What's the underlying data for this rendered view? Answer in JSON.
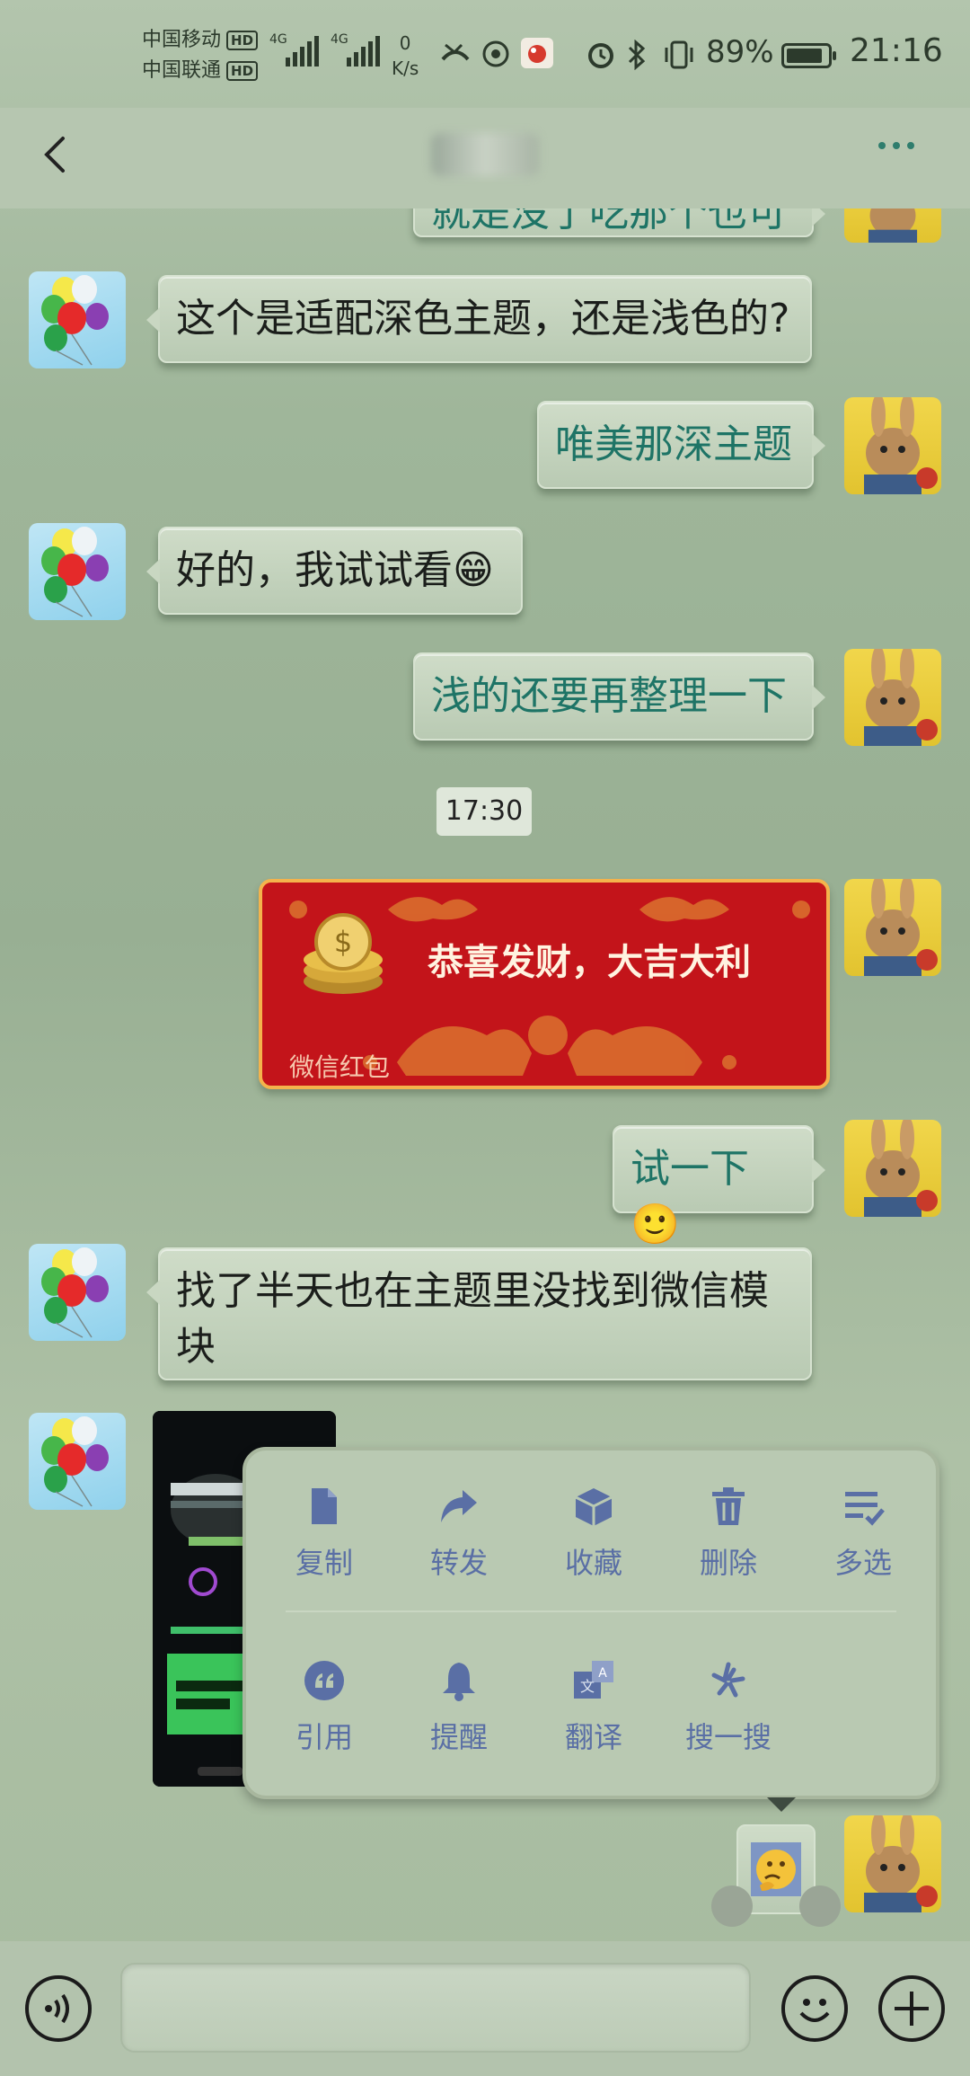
{
  "status_bar": {
    "carrier_1": "中国移动",
    "carrier_2": "中国联通",
    "hd_label": "HD",
    "network_type": "4G",
    "net_speed_value": "0",
    "net_speed_unit": "K/s",
    "battery_percent": "89%",
    "battery_level": 0.89,
    "time": "21:16"
  },
  "nav": {
    "back_icon": "chevron-left-icon",
    "more_icon": "more-dots-icon",
    "accent_color": "#2f7d6d"
  },
  "messages": [
    {
      "side": "right",
      "text": "就是没了吃那个也可"
    },
    {
      "side": "left",
      "text": "这个是适配深色主题，还是浅色的?"
    },
    {
      "side": "right",
      "text": "唯美那深主题"
    },
    {
      "side": "left",
      "text": "好的，我试试看😁"
    },
    {
      "side": "right",
      "text": "浅的还要再整理一下"
    },
    {
      "side": "right",
      "text": "试一下🙂"
    },
    {
      "side": "left",
      "text": "找了半天也在主题里没找到微信模块"
    }
  ],
  "timestamp": "17:30",
  "red_packet": {
    "greeting": "恭喜发财，大吉大利",
    "footer": "微信红包"
  },
  "context_menu": {
    "row1": [
      {
        "label": "复制",
        "icon": "copy-icon"
      },
      {
        "label": "转发",
        "icon": "forward-icon"
      },
      {
        "label": "收藏",
        "icon": "favorite-box-icon"
      },
      {
        "label": "删除",
        "icon": "trash-icon"
      },
      {
        "label": "多选",
        "icon": "multiselect-icon"
      }
    ],
    "row2": [
      {
        "label": "引用",
        "icon": "quote-icon"
      },
      {
        "label": "提醒",
        "icon": "bell-icon"
      },
      {
        "label": "翻译",
        "icon": "translate-icon"
      },
      {
        "label": "搜一搜",
        "icon": "search-sparkle-icon"
      }
    ],
    "icon_color": "#5a6fa5"
  },
  "input_bar": {
    "voice_icon": "voice-icon",
    "emoji_icon": "emoji-icon",
    "plus_icon": "plus-icon",
    "value": ""
  },
  "colors": {
    "outgoing_text": "#1e7466",
    "incoming_text": "#1b1e1b",
    "red_packet": "#c3141a"
  }
}
